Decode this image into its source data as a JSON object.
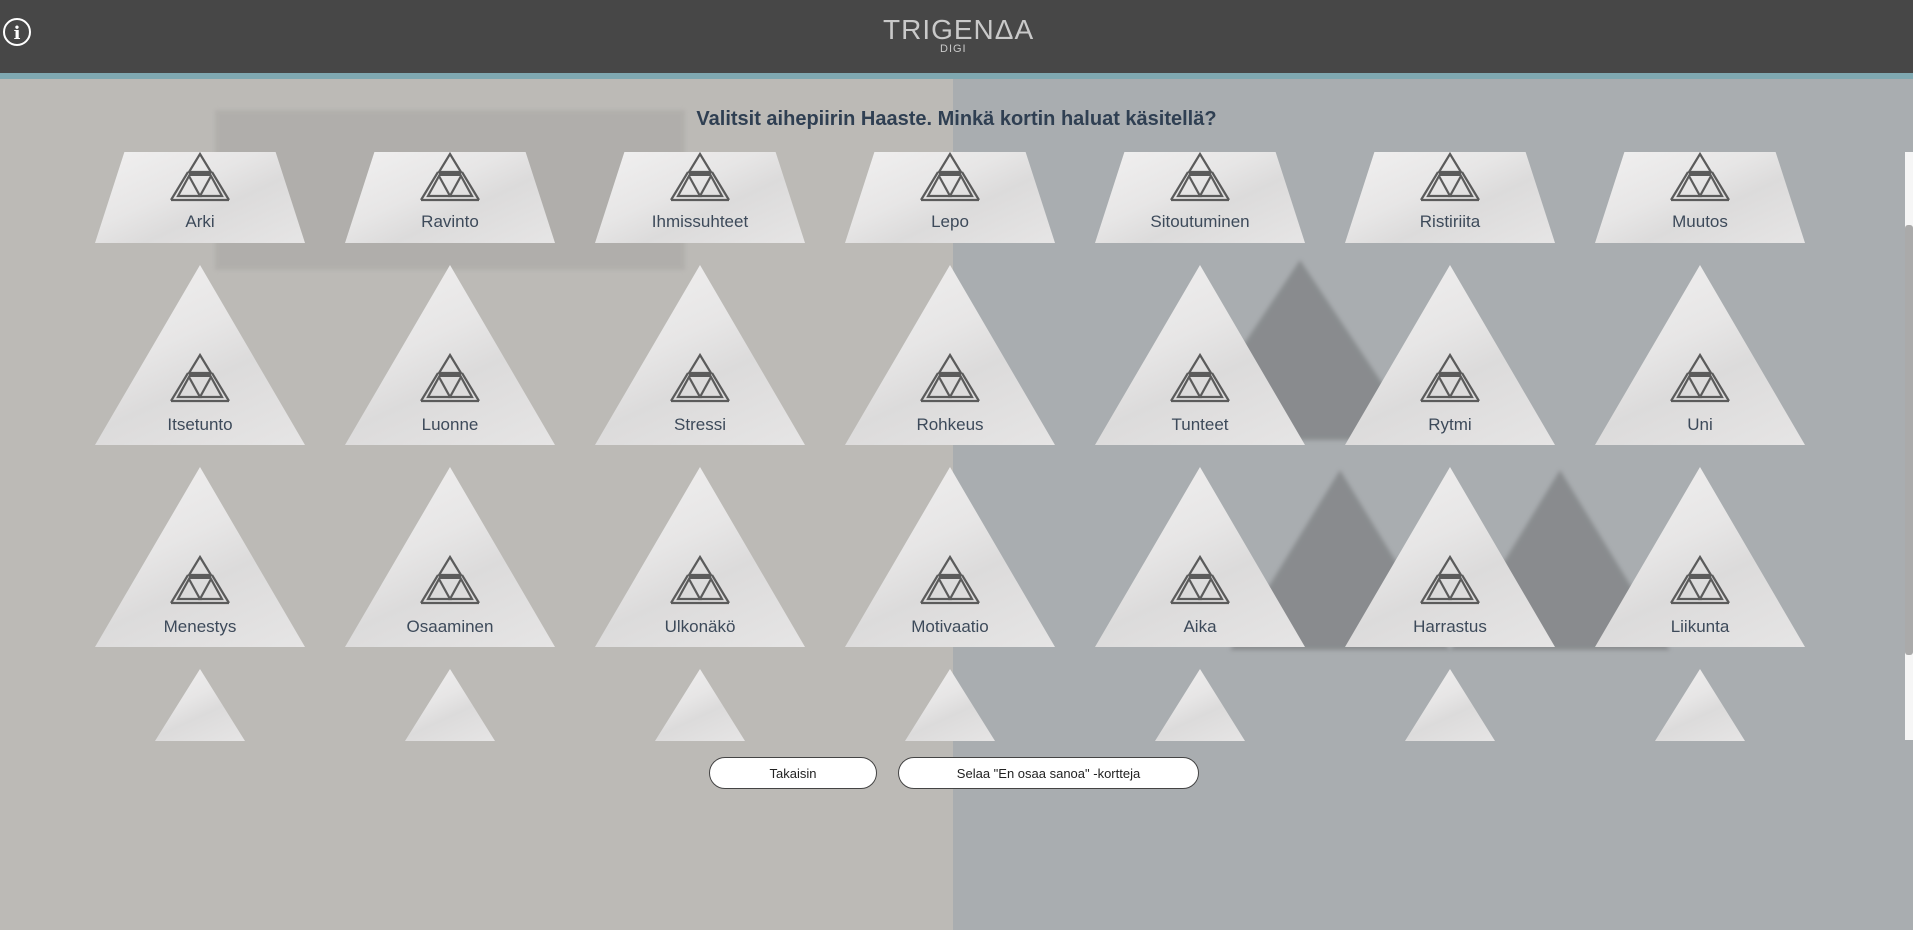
{
  "header": {
    "logo_text": "TRIGENΔA",
    "logo_sub": "DIGI",
    "info_label": "i"
  },
  "prompt": "Valitsit aihepiirin Haaste. Minkä kortin haluat käsitellä?",
  "cards": {
    "row1": [
      "Arki",
      "Ravinto",
      "Ihmissuhteet",
      "Lepo",
      "Sitoutuminen",
      "Ristiriita",
      "Muutos"
    ],
    "row2": [
      "Itsetunto",
      "Luonne",
      "Stressi",
      "Rohkeus",
      "Tunteet",
      "Rytmi",
      "Uni"
    ],
    "row3": [
      "Menestys",
      "Osaaminen",
      "Ulkonäkö",
      "Motivaatio",
      "Aika",
      "Harrastus",
      "Liikunta"
    ]
  },
  "buttons": {
    "back": "Takaisin",
    "browse": "Selaa \"En osaa sanoa\" -kortteja"
  },
  "colors": {
    "topbar": "#474747",
    "accent_line": "#7fa8b1",
    "prompt_text": "#2f3f52"
  },
  "icons": {
    "card": "trigenda-triangle-icon",
    "info": "info-icon"
  }
}
